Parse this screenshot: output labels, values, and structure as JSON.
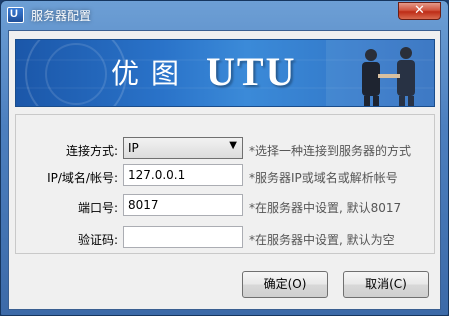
{
  "window": {
    "title": "服务器配置",
    "icon_text": "U",
    "close_glyph": "✕"
  },
  "banner": {
    "chinese_text": "优图",
    "logo_text": "UTU"
  },
  "form": {
    "connection": {
      "label": "连接方式:",
      "value": "IP",
      "hint": "*选择一种连接到服务器的方式"
    },
    "address": {
      "label": "IP/域名/帐号:",
      "value": "127.0.0.1",
      "hint": "*服务器IP或域名或解析帐号"
    },
    "port": {
      "label": "端口号:",
      "value": "8017",
      "hint": "*在服务器中设置, 默认8017"
    },
    "verify": {
      "label": "验证码:",
      "value": "",
      "hint": "*在服务器中设置, 默认为空"
    }
  },
  "buttons": {
    "ok": "确定(O)",
    "cancel": "取消(C)"
  }
}
